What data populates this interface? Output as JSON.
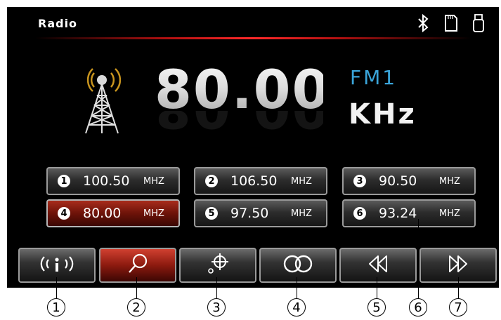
{
  "header": {
    "title": "Radio",
    "status_icons": [
      "bluetooth-icon",
      "sd-card-icon",
      "usb-icon"
    ]
  },
  "tuner": {
    "frequency": "80.00",
    "band": "FM1",
    "unit": "KHz"
  },
  "presets": [
    {
      "num": "1",
      "freq": "100.50",
      "unit": "MHZ",
      "active": false
    },
    {
      "num": "2",
      "freq": "106.50",
      "unit": "MHZ",
      "active": false
    },
    {
      "num": "3",
      "freq": "90.50",
      "unit": "MHZ",
      "active": false
    },
    {
      "num": "4",
      "freq": "80.00",
      "unit": "MHZ",
      "active": true
    },
    {
      "num": "5",
      "freq": "97.50",
      "unit": "MHZ",
      "active": false
    },
    {
      "num": "6",
      "freq": "93.24",
      "unit": "MHZ",
      "active": false
    }
  ],
  "controls": [
    {
      "name": "radio-broadcast-button",
      "icon": "broadcast-icon"
    },
    {
      "name": "search-button",
      "icon": "search-icon"
    },
    {
      "name": "locate-button",
      "icon": "crosshair-icon"
    },
    {
      "name": "stereo-button",
      "icon": "stereo-icon"
    },
    {
      "name": "previous-button",
      "icon": "rewind-icon"
    },
    {
      "name": "next-button",
      "icon": "fast-forward-icon"
    }
  ],
  "callouts": [
    "1",
    "2",
    "3",
    "4",
    "5",
    "6",
    "7"
  ],
  "colors": {
    "accent_red": "#b01010",
    "band_blue": "#3aa4d9",
    "active_preset": "#6d1309"
  }
}
